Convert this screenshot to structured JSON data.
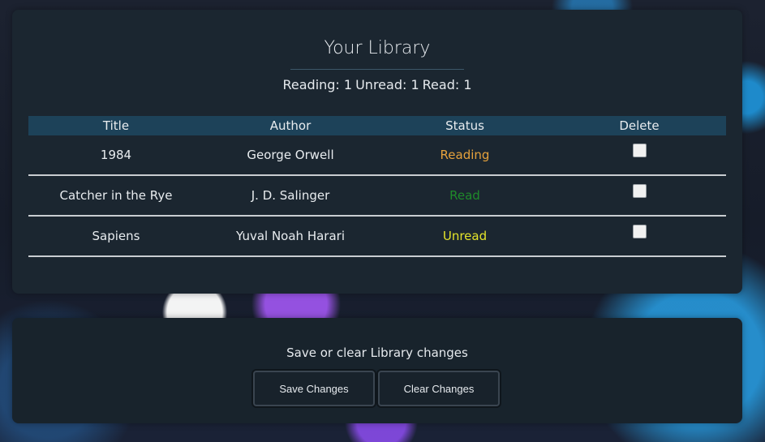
{
  "library": {
    "title": "Your Library",
    "counts": {
      "reading_label": "Reading: 1",
      "unread_label": "Unread: 1",
      "read_label": "Read: 1"
    },
    "columns": [
      "Title",
      "Author",
      "Status",
      "Delete"
    ],
    "books": [
      {
        "title": "1984",
        "author": "George Orwell",
        "status": "Reading",
        "status_color": "#e6a23c",
        "delete_checked": false
      },
      {
        "title": "Catcher in the Rye",
        "author": "J. D. Salinger",
        "status": "Read",
        "status_color": "#1f8a2a",
        "delete_checked": false
      },
      {
        "title": "Sapiens",
        "author": "Yuval Noah Harari",
        "status": "Unread",
        "status_color": "#e3e32a",
        "delete_checked": false
      }
    ]
  },
  "actions": {
    "prompt": "Save or clear Library changes",
    "save_label": "Save Changes",
    "clear_label": "Clear Changes"
  }
}
